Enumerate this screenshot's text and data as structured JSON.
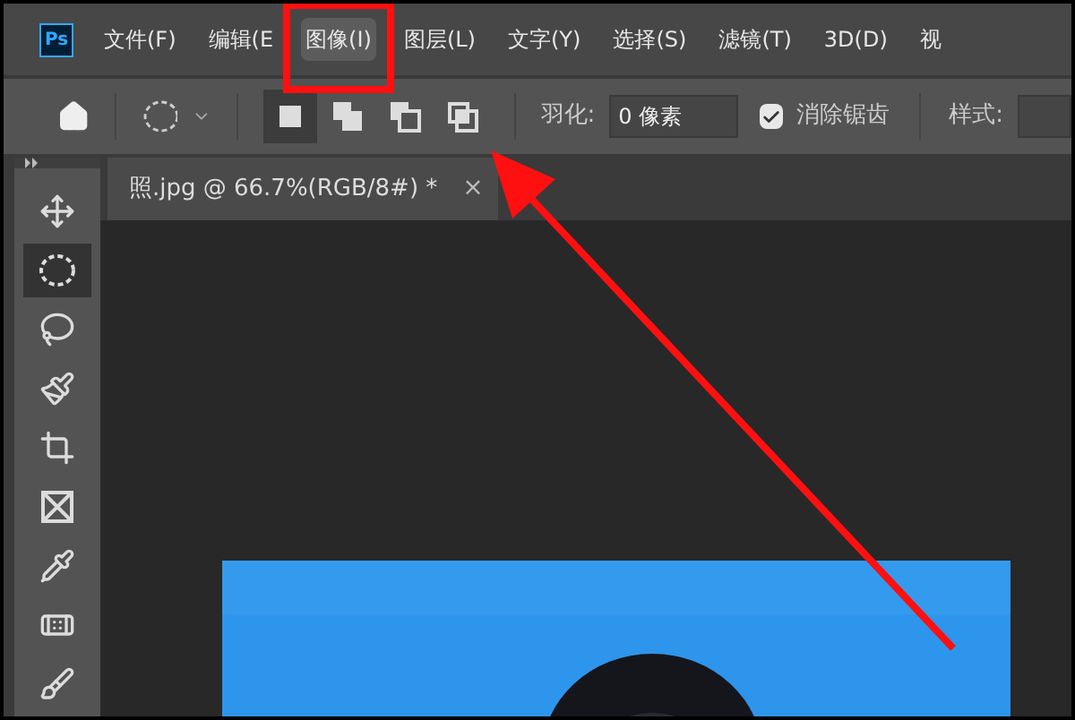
{
  "app_logo": "Ps",
  "menu": [
    {
      "label": "文件(F)",
      "selected": false
    },
    {
      "label": "编辑(E",
      "selected": false
    },
    {
      "label": "图像(I)",
      "selected": true
    },
    {
      "label": "图层(L)",
      "selected": false
    },
    {
      "label": "文字(Y)",
      "selected": false
    },
    {
      "label": "选择(S)",
      "selected": false
    },
    {
      "label": "滤镜(T)",
      "selected": false
    },
    {
      "label": "3D(D)",
      "selected": false
    },
    {
      "label": "视",
      "selected": false
    }
  ],
  "options_bar": {
    "selection_modes": [
      {
        "kind": "new",
        "selected": true
      },
      {
        "kind": "add",
        "selected": false
      },
      {
        "kind": "subtract",
        "selected": false
      },
      {
        "kind": "intersect",
        "selected": false
      }
    ],
    "feather_label": "羽化:",
    "feather_value": "0 像素",
    "antialias": {
      "label": "消除锯齿",
      "checked": true
    },
    "style_label": "样式:"
  },
  "tools": [
    {
      "kind": "move",
      "selected": false
    },
    {
      "kind": "marquee",
      "selected": true
    },
    {
      "kind": "lasso",
      "selected": false
    },
    {
      "kind": "quick",
      "selected": false
    },
    {
      "kind": "crop",
      "selected": false
    },
    {
      "kind": "frame",
      "selected": false
    },
    {
      "kind": "eyedropper",
      "selected": false
    },
    {
      "kind": "heal",
      "selected": false
    },
    {
      "kind": "brush",
      "selected": false
    }
  ],
  "document_tab": {
    "title": "照.jpg @ 66.7%(RGB/8#) *",
    "close": "×"
  }
}
